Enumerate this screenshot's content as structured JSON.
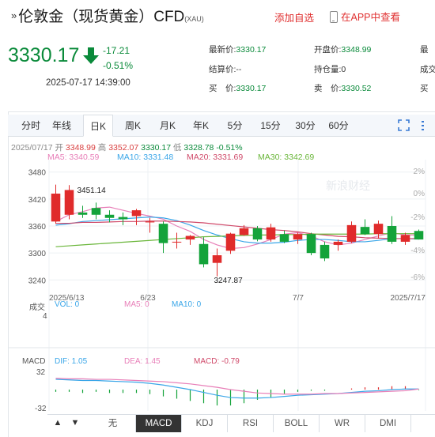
{
  "header": {
    "prefix_icon": "double-chevron-right",
    "title": "伦敦金（现货黄金）CFD",
    "symbol": "(XAU)",
    "add_favorite": "添加自选",
    "open_in_app": "在APP中查看"
  },
  "quote": {
    "price": "3330.17",
    "change": "-17.21",
    "change_pct": "-0.51%",
    "timestamp": "2025-07-17 14:39:00",
    "direction": "down",
    "color_down": "#0a8a3a",
    "color_up": "#d94040"
  },
  "quote_grid": [
    {
      "label": "最新价:",
      "value": "3330.17"
    },
    {
      "label": "开盘价:",
      "value": "3348.99"
    },
    {
      "label": "最",
      "value": ""
    },
    {
      "label": "结算价:",
      "value": "--"
    },
    {
      "label": "持仓量:",
      "value": "0"
    },
    {
      "label": "成交",
      "value": ""
    },
    {
      "label": "买　价:",
      "value": "3330.17"
    },
    {
      "label": "卖　价:",
      "value": "3330.52"
    },
    {
      "label": "买",
      "value": ""
    }
  ],
  "tabs": [
    "分时",
    "年线",
    "日K",
    "周K",
    "月K",
    "年K",
    "5分",
    "15分",
    "30分",
    "60分"
  ],
  "active_tab": "日K",
  "ohlc_line": {
    "date": "2025/07/17",
    "open_label": "开",
    "open": "3348.99",
    "high_label": "高",
    "high": "3352.07",
    "low_label": "低",
    "low": "3330.17",
    "close": "3328.78",
    "pct": "-0.51%"
  },
  "ma_line": {
    "ma5": "MA5: 3340.59",
    "ma10": "MA10: 3331.48",
    "ma20": "MA20: 3331.69",
    "ma30": "MA30: 3342.69"
  },
  "price_axis": [
    "3480",
    "3420",
    "3360",
    "3300",
    "3240"
  ],
  "pct_axis": [
    "2%",
    "0%",
    "-2%",
    "-4%",
    "-6%"
  ],
  "date_axis": [
    "2025/6/13",
    "6/23",
    "7/7",
    "2025/7/17"
  ],
  "high_marker": "3451.14",
  "low_marker": "3247.87",
  "watermark": "新浪财经",
  "volume": {
    "label": "成交",
    "vol": "VOL: 0",
    "ma5": "MA5: 0",
    "ma10": "MA10: 0",
    "axis_top": "4"
  },
  "macd": {
    "label": "MACD",
    "dif": "DIF: 1.05",
    "dea": "DEA: 1.45",
    "macd": "MACD: -0.79",
    "axis_top": "32",
    "axis_bottom": "-32"
  },
  "indicator_tabs": [
    "无",
    "MACD",
    "KDJ",
    "RSI",
    "BOLL",
    "WR",
    "DMI"
  ],
  "active_indicator": "MACD",
  "nav": {
    "left": "▲",
    "right": "▼"
  },
  "chart_data": {
    "type": "candlestick",
    "x_range": [
      "2025/6/13",
      "2025/7/17"
    ],
    "ylim": [
      3230,
      3490
    ],
    "candles": [
      {
        "o": 3370,
        "h": 3452,
        "l": 3365,
        "c": 3432
      },
      {
        "o": 3385,
        "h": 3451,
        "l": 3375,
        "c": 3440
      },
      {
        "o": 3390,
        "h": 3405,
        "l": 3378,
        "c": 3385
      },
      {
        "o": 3400,
        "h": 3412,
        "l": 3375,
        "c": 3385
      },
      {
        "o": 3385,
        "h": 3395,
        "l": 3368,
        "c": 3378
      },
      {
        "o": 3380,
        "h": 3390,
        "l": 3362,
        "c": 3375
      },
      {
        "o": 3382,
        "h": 3398,
        "l": 3362,
        "c": 3395
      },
      {
        "o": 3368,
        "h": 3378,
        "l": 3345,
        "c": 3370
      },
      {
        "o": 3365,
        "h": 3370,
        "l": 3300,
        "c": 3322
      },
      {
        "o": 3325,
        "h": 3345,
        "l": 3310,
        "c": 3325
      },
      {
        "o": 3330,
        "h": 3340,
        "l": 3318,
        "c": 3338
      },
      {
        "o": 3320,
        "h": 3335,
        "l": 3268,
        "c": 3275
      },
      {
        "o": 3278,
        "h": 3310,
        "l": 3248,
        "c": 3295
      },
      {
        "o": 3305,
        "h": 3345,
        "l": 3298,
        "c": 3343
      },
      {
        "o": 3340,
        "h": 3362,
        "l": 3338,
        "c": 3355
      },
      {
        "o": 3355,
        "h": 3360,
        "l": 3326,
        "c": 3330
      },
      {
        "o": 3330,
        "h": 3365,
        "l": 3325,
        "c": 3357
      },
      {
        "o": 3342,
        "h": 3350,
        "l": 3322,
        "c": 3325
      },
      {
        "o": 3330,
        "h": 3345,
        "l": 3320,
        "c": 3342
      },
      {
        "o": 3342,
        "h": 3345,
        "l": 3295,
        "c": 3300
      },
      {
        "o": 3318,
        "h": 3325,
        "l": 3282,
        "c": 3288
      },
      {
        "o": 3318,
        "h": 3330,
        "l": 3305,
        "c": 3325
      },
      {
        "o": 3325,
        "h": 3370,
        "l": 3322,
        "c": 3362
      },
      {
        "o": 3358,
        "h": 3375,
        "l": 3340,
        "c": 3342
      },
      {
        "o": 3342,
        "h": 3372,
        "l": 3332,
        "c": 3365
      },
      {
        "o": 3360,
        "h": 3382,
        "l": 3320,
        "c": 3325
      },
      {
        "o": 3325,
        "h": 3345,
        "l": 3318,
        "c": 3340
      },
      {
        "o": 3349,
        "h": 3352,
        "l": 3330,
        "c": 3330
      }
    ],
    "ma_series": [
      {
        "name": "MA5",
        "color": "#e87fb8",
        "values": [
          3370,
          3385,
          3392,
          3400,
          3402,
          3395,
          3388,
          3382,
          3375,
          3360,
          3348,
          3330,
          3318,
          3310,
          3312,
          3320,
          3330,
          3342,
          3345,
          3338,
          3325,
          3318,
          3322,
          3330,
          3338,
          3345,
          3340,
          3340
        ]
      },
      {
        "name": "MA10",
        "color": "#3aa6e8",
        "values": [
          3362,
          3365,
          3370,
          3372,
          3374,
          3376,
          3378,
          3380,
          3378,
          3372,
          3362,
          3350,
          3340,
          3332,
          3325,
          3322,
          3322,
          3324,
          3328,
          3330,
          3330,
          3328,
          3325,
          3325,
          3328,
          3332,
          3332,
          3331
        ]
      },
      {
        "name": "MA20",
        "color": "#d04a6a",
        "values": [
          3366,
          3366,
          3368,
          3368,
          3369,
          3370,
          3370,
          3371,
          3371,
          3370,
          3369,
          3367,
          3364,
          3361,
          3358,
          3355,
          3352,
          3350,
          3347,
          3343,
          3340,
          3337,
          3336,
          3334,
          3333,
          3332,
          3332,
          3332
        ]
      },
      {
        "name": "MA30",
        "color": "#6ab63a",
        "values": [
          3314,
          3316,
          3318,
          3320,
          3322,
          3324,
          3326,
          3328,
          3330,
          3332,
          3334,
          3336,
          3337,
          3338,
          3339,
          3340,
          3340,
          3341,
          3341,
          3342,
          3342,
          3342,
          3342,
          3342,
          3343,
          3343,
          3343,
          3343
        ]
      }
    ],
    "macd_series": {
      "dif": [
        18,
        17,
        16,
        16,
        15,
        14,
        13,
        11,
        8,
        4,
        0,
        -5,
        -10,
        -14,
        -15,
        -15,
        -14,
        -12,
        -10,
        -9,
        -8,
        -7,
        -5,
        -3,
        -2,
        0,
        1,
        1
      ],
      "dea": [
        20,
        19,
        19,
        18,
        18,
        17,
        16,
        15,
        14,
        12,
        10,
        7,
        4,
        0,
        -3,
        -6,
        -7,
        -8,
        -8,
        -8,
        -7,
        -7,
        -6,
        -5,
        -4,
        -3,
        -2,
        1
      ],
      "hist": [
        -4,
        -4,
        -6,
        -4,
        -6,
        -6,
        -6,
        -8,
        -12,
        -16,
        -20,
        -24,
        -28,
        -28,
        -24,
        -18,
        -14,
        -8,
        -4,
        -2,
        -2,
        0,
        2,
        4,
        4,
        6,
        6,
        -1
      ]
    }
  }
}
